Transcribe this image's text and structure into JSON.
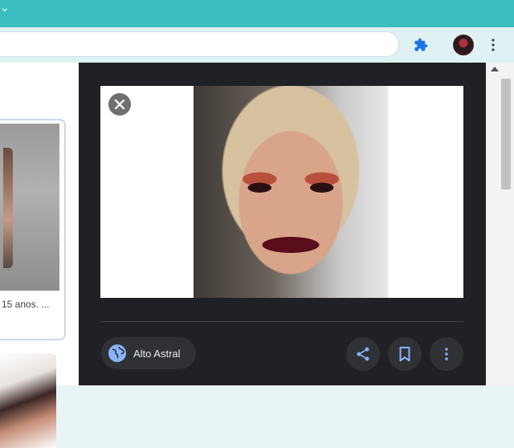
{
  "browser": {
    "titlebar_color": "#3bbec0",
    "icons": {
      "extensions": "puzzle-icon",
      "menu": "vertical-dots-icon"
    }
  },
  "results": {
    "caption": "15 anos. ..."
  },
  "preview": {
    "close_icon": "close-icon",
    "source_name": "Alto Astral",
    "source_icon": "globe-icon",
    "actions": {
      "share": "share-icon",
      "save": "bookmark-icon",
      "more": "more-vert-icon"
    },
    "accent_color": "#8ab4f8"
  }
}
